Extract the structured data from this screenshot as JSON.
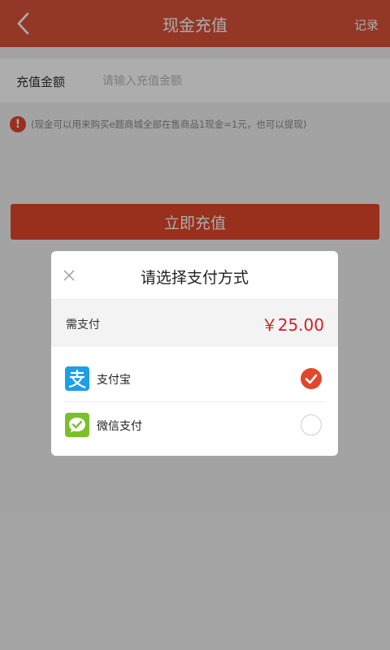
{
  "header": {
    "title": "现金充值",
    "record_label": "记录"
  },
  "form": {
    "amount_label": "充值金额",
    "amount_placeholder": "请输入充值金额",
    "amount_value": ""
  },
  "notice": {
    "text": "(现金可以用来购买e题商城全部在售商品1现金=1元，也可以提现)"
  },
  "actions": {
    "recharge_label": "立即充值"
  },
  "dialog": {
    "title": "请选择支付方式",
    "pay_label": "需支付",
    "pay_amount": "￥25.00",
    "methods": [
      {
        "label": "支付宝",
        "icon": "alipay-icon",
        "selected": true
      },
      {
        "label": "微信支付",
        "icon": "wechat-pay-icon",
        "selected": false
      }
    ]
  },
  "colors": {
    "brand": "#d9533a",
    "accent": "#e1472c",
    "price": "#d6202a",
    "alipay": "#1e9ee5",
    "wechat": "#7bbf2a"
  }
}
